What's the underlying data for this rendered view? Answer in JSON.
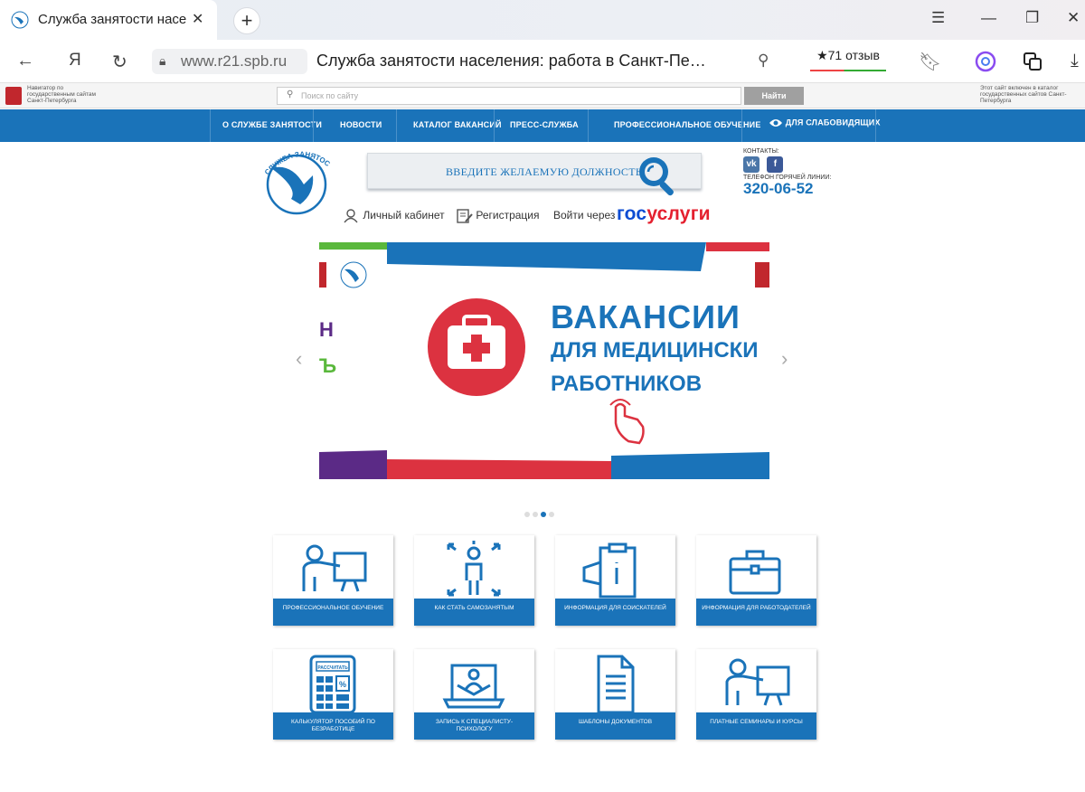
{
  "browser": {
    "tab_title": "Служба занятости насе",
    "url": "www.r21.spb.ru",
    "page_title": "Служба занятости населения: работа в Санкт-Пе…",
    "reviews": "★71 отзыв"
  },
  "gov_strip": {
    "left_text": "Навигатор по государственным сайтам Санкт-Петербурга",
    "search_placeholder": "Поиск по сайту",
    "search_button": "Найти",
    "right_text": "Этот сайт включен в каталог государственных сайтов Санкт-Петербурга"
  },
  "nav": {
    "items": [
      "О СЛУЖБЕ ЗАНЯТОСТИ",
      "НОВОСТИ",
      "КАТАЛОГ ВАКАНСИЙ",
      "ПРЕСС-СЛУЖБА",
      "ПРОФЕССИОНАЛЬНОЕ ОБУЧЕНИЕ",
      "ДЛЯ СЛАБОВИДЯЩИХ"
    ]
  },
  "header": {
    "logo_text": "СЛУЖБА ЗАНЯТОСТИ",
    "vacancy_search": "ВВЕДИТЕ ЖЕЛАЕМУЮ ДОЛЖНОСТЬ",
    "contacts_label": "КОНТАКТЫ:",
    "hotline_label": "ТЕЛЕФОН ГОРЯЧЕЙ ЛИНИИ:",
    "hotline_phone": "320-06-52",
    "personal_cabinet": "Личный кабинет",
    "registration": "Регистрация",
    "login_via": "Войти через",
    "gosuslugi_a": "гос",
    "gosuslugi_b": "услуги"
  },
  "banner": {
    "line1": "ВАКАНСИИ",
    "line2": "ДЛЯ МЕДИЦИНСКИ",
    "line3": "РАБОТНИКОВ",
    "left_peek_1": "Н",
    "left_peek_2": "Ъ",
    "slide_count": 4,
    "active_slide": 3
  },
  "tiles": [
    {
      "label": "Профессиональное обучение",
      "icon": "teacher-icon"
    },
    {
      "label": "Как стать самозанятым",
      "icon": "person-arrows-icon"
    },
    {
      "label": "Информация для соискателей",
      "icon": "clipboard-info-icon"
    },
    {
      "label": "Информация для работодателей",
      "icon": "briefcase-icon"
    },
    {
      "label": "Калькулятор пособий по безработице",
      "icon": "calculator-icon"
    },
    {
      "label": "Запись к специалисту-психологу",
      "icon": "laptop-person-icon"
    },
    {
      "label": "Шаблоны документов",
      "icon": "document-icon"
    },
    {
      "label": "Платные семинары и курсы",
      "icon": "teacher-icon"
    }
  ],
  "calculator_button": "РАССЧИТАТЬ",
  "colors": {
    "brand_blue": "#1a73b9",
    "red": "#dc3240",
    "purple": "#5b2a86",
    "green": "#5ab83c"
  }
}
